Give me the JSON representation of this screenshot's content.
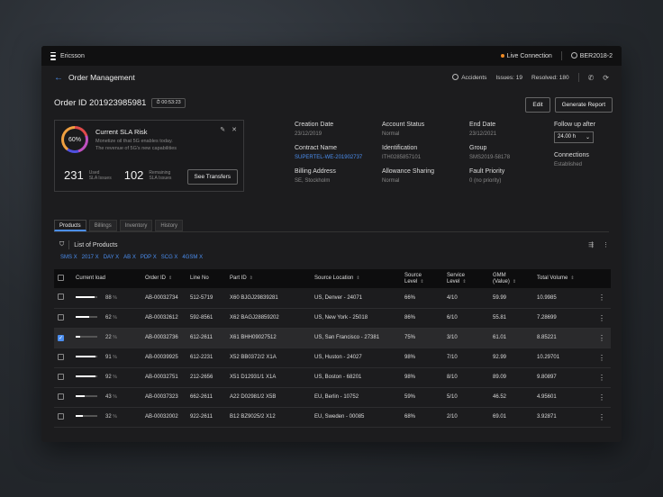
{
  "topbar": {
    "brand": "Ericsson",
    "live": "Live Connection",
    "user": "BER2018-2"
  },
  "header": {
    "title": "Order Management",
    "accidents": "Accidents",
    "issues": "Issues: 19",
    "resolved": "Resolved: 180"
  },
  "order": {
    "id": "Order ID 201923985981",
    "timer": "00:53:23",
    "edit": "Edit",
    "report": "Generate Report"
  },
  "sla": {
    "percent": "60%",
    "title": "Current SLA Risk",
    "desc1": "Monetize oil that 5G enables today.",
    "desc2": "The revenue of 5G's new capabilities",
    "used_val": "231",
    "used_lbl1": "Used",
    "used_lbl2": "SLA Issues",
    "rem_val": "102",
    "rem_lbl1": "Remaining",
    "rem_lbl2": "SLA Issues",
    "button": "See Transfers"
  },
  "details": [
    {
      "k": "Creation Date",
      "v": "23/12/2019"
    },
    {
      "k": "Account Status",
      "v": "Normal"
    },
    {
      "k": "End Date",
      "v": "23/12/2021"
    },
    {
      "k": "Contract Name",
      "v": "SUPERTEL-WE-201902737"
    },
    {
      "k": "Identification",
      "v": "ITH0285857101"
    },
    {
      "k": "Group",
      "v": "SMS2019-58178"
    },
    {
      "k": "Billing Address",
      "v": "SE, Stockholm"
    },
    {
      "k": "Allowance Sharing",
      "v": "Normal"
    },
    {
      "k": "Fault Priority",
      "v": "0 (no priority)"
    }
  ],
  "follow": {
    "label": "Follow up after",
    "value": "24.00 h",
    "conn_label": "Connections",
    "conn_value": "Established"
  },
  "tabs": [
    "Products",
    "Billings",
    "Inventory",
    "History"
  ],
  "list": {
    "title": "List of Products",
    "chips": [
      "SMS X",
      "2017 X",
      "DAY X",
      "AB X",
      "PDP X",
      "SCG X",
      "4GSM X"
    ]
  },
  "columns": [
    "Current load",
    "Order ID",
    "Line No",
    "Part ID",
    "Source Location",
    "Source Level",
    "Service Level",
    "GMM (Value)",
    "Total Volume"
  ],
  "rows": [
    {
      "load": 88,
      "order": "AB-00032734",
      "line": "512-5719",
      "part": "X60 BJGJ29839281",
      "loc": "US, Denver - 24071",
      "src": "66%",
      "svc": "4/10",
      "gmm": "59.99",
      "vol": "10.9985",
      "checked": false
    },
    {
      "load": 62,
      "order": "AB-00032612",
      "line": "592-8561",
      "part": "X62 BAGJ28859202",
      "loc": "US, New York - 25018",
      "src": "86%",
      "svc": "6/10",
      "gmm": "55.81",
      "vol": "7.28699",
      "checked": false
    },
    {
      "load": 22,
      "order": "AB-00032736",
      "line": "612-2611",
      "part": "X61 BHH09027512",
      "loc": "US, San Francisco - 27381",
      "src": "75%",
      "svc": "3/10",
      "gmm": "61.01",
      "vol": "8.85221",
      "checked": true
    },
    {
      "load": 91,
      "order": "AB-00039925",
      "line": "612-2231",
      "part": "X52 BB0372/2 X1A",
      "loc": "US, Huston - 24027",
      "src": "98%",
      "svc": "7/10",
      "gmm": "92.99",
      "vol": "10.29701",
      "checked": false
    },
    {
      "load": 92,
      "order": "AB-00032751",
      "line": "212-2656",
      "part": "X51 D12931/1 X1A",
      "loc": "US, Boston - 68201",
      "src": "98%",
      "svc": "8/10",
      "gmm": "89.09",
      "vol": "9.80897",
      "checked": false
    },
    {
      "load": 43,
      "order": "AB-00037323",
      "line": "662-2611",
      "part": "A22 D02981/2 X5B",
      "loc": "EU, Berlin - 10752",
      "src": "59%",
      "svc": "5/10",
      "gmm": "46.52",
      "vol": "4.95601",
      "checked": false
    },
    {
      "load": 32,
      "order": "AB-00032002",
      "line": "922-2611",
      "part": "B12 BZ9025/2 X12",
      "loc": "EU, Sweden - 00085",
      "src": "68%",
      "svc": "2/10",
      "gmm": "69.01",
      "vol": "3.92871",
      "checked": false
    }
  ]
}
